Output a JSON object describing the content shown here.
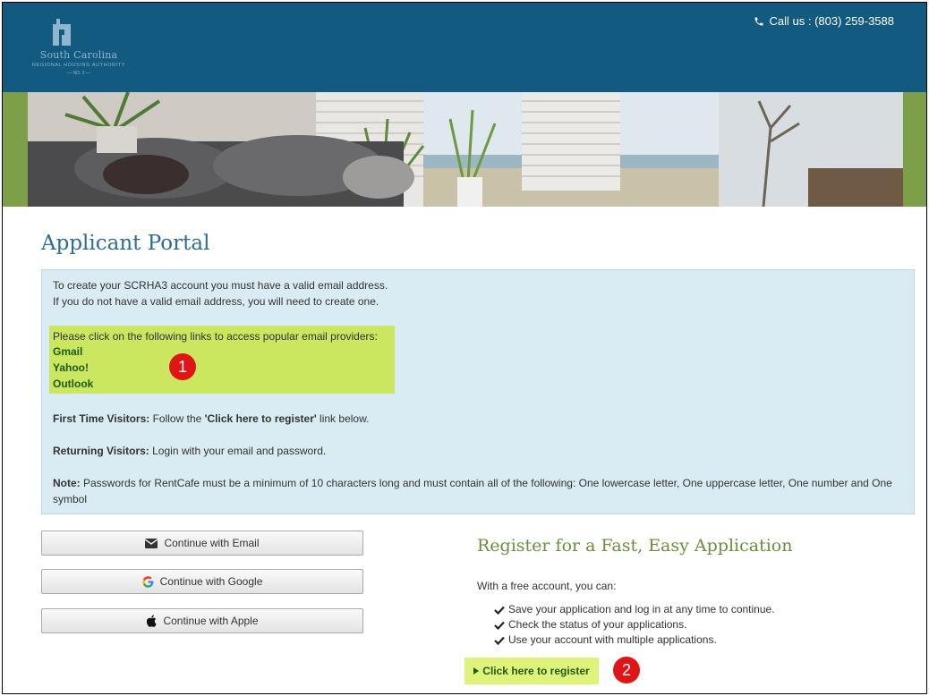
{
  "colors": {
    "header_bg": "#125a80",
    "title_color": "#2e6d94",
    "info_bg": "#d9ebf3",
    "highlight": "#cbe65f",
    "link_green": "#1d5a12",
    "badge_red": "#e01616",
    "register_title": "#6a8f3a"
  },
  "header": {
    "logo": {
      "name": "South Carolina",
      "sub": "REGIONAL HOUSING AUTHORITY",
      "est": "— NO. 3 —",
      "icon": "building-logo"
    },
    "call": {
      "icon": "phone-icon",
      "text": "Call us : (803) 259-3588"
    }
  },
  "page": {
    "title": "Applicant Portal"
  },
  "info": {
    "line1": "To create your SCRHA3 account you must have a valid email address.",
    "line2": "If you do not have a valid email address, you will need to create one.",
    "providers_intro": "Please click on the following links to access popular email providers:",
    "providers": [
      "Gmail",
      "Yahoo!",
      "Outlook"
    ],
    "first_time_label": "First Time Visitors:",
    "first_time_text": " Follow the ",
    "first_time_link": "'Click here to register'",
    "first_time_end": " link below.",
    "returning_label": "Returning Visitors:",
    "returning_text": " Login with your email and password.",
    "note_label": "Note:",
    "note_text": " Passwords for RentCafe must be a minimum of 10 characters long and must contain all of the following: One lowercase letter, One uppercase letter, One number and One symbol"
  },
  "login": {
    "email_label": "Continue with Email",
    "google_label": "Continue with Google",
    "apple_label": "Continue with Apple"
  },
  "register": {
    "title": "Register for a Fast, Easy Application",
    "intro": "With a free account, you can:",
    "benefits": [
      "Save your application and log in at any time to continue.",
      "Check the status of your applications.",
      "Use your account with multiple applications."
    ],
    "link": "Click here to register"
  },
  "badges": [
    "1",
    "2"
  ]
}
